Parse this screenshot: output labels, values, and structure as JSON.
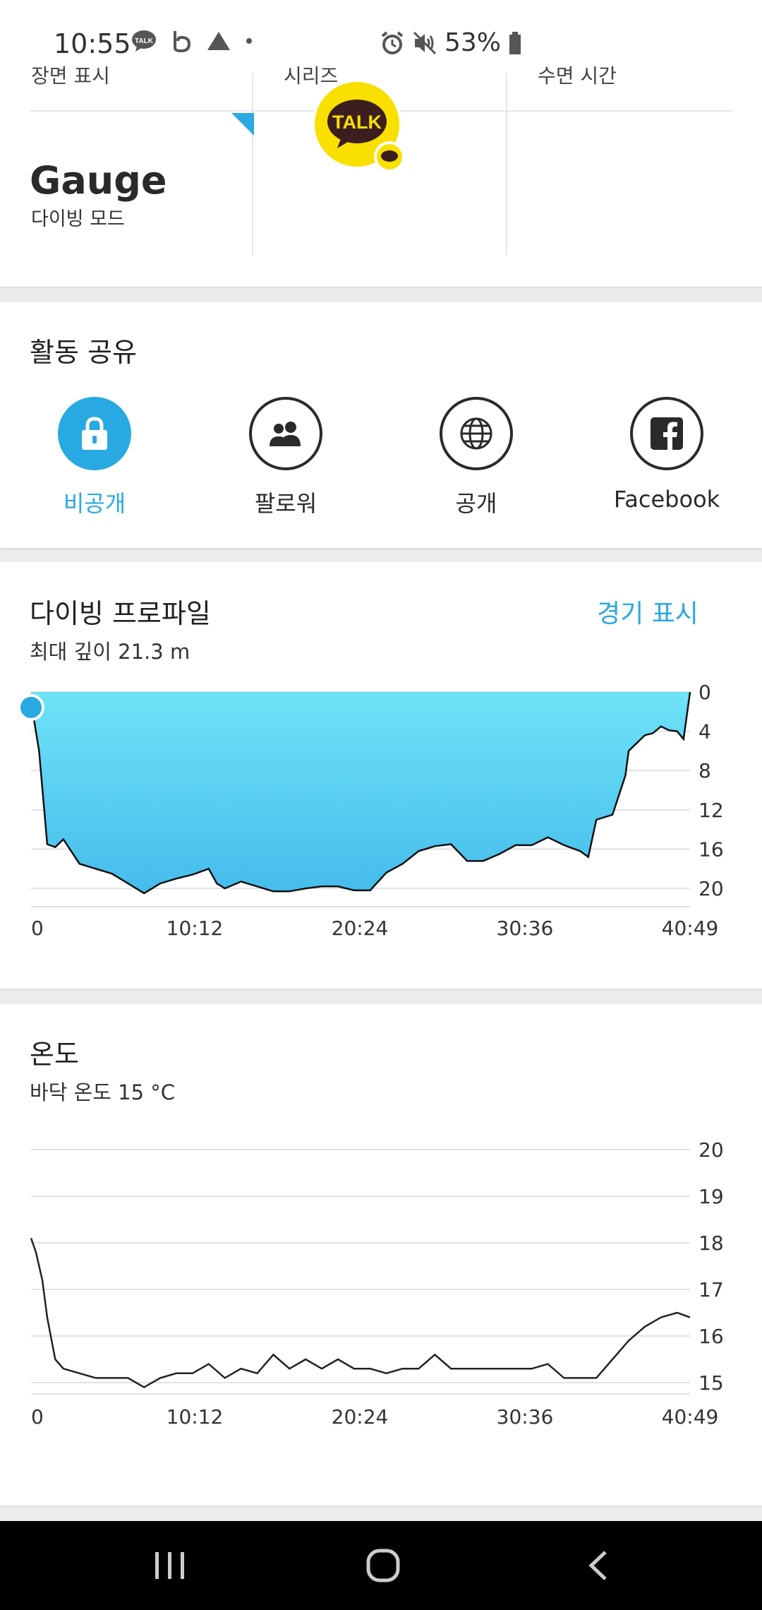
{
  "status_bar": {
    "time": "10:55",
    "battery": "53%"
  },
  "mode_card": {
    "cut_labels": [
      "장면 표시",
      "시리즈",
      "수면 시간"
    ],
    "mode_value": "Gauge",
    "mode_label": "다이빙 모드",
    "kakao_badge": "TALK"
  },
  "share": {
    "title": "활동 공유",
    "options": [
      {
        "label": "비공개",
        "icon": "lock-icon",
        "active": true
      },
      {
        "label": "팔로워",
        "icon": "people-icon",
        "active": false
      },
      {
        "label": "공개",
        "icon": "globe-icon",
        "active": false
      },
      {
        "label": "Facebook",
        "icon": "facebook-icon",
        "active": false
      }
    ],
    "accent": "#29a9e1"
  },
  "depth_profile": {
    "title": "다이빙 프로파일",
    "action": "경기 표시",
    "subtitle": "최대 깊이 21.3 m"
  },
  "temperature": {
    "title": "온도",
    "subtitle": "바닥 온도 15 °C"
  },
  "chart_data": [
    {
      "type": "area",
      "x_tick_labels": [
        "0",
        "10:12",
        "20:24",
        "30:36",
        "40:49"
      ],
      "y_tick_labels": [
        "0",
        "4",
        "8",
        "12",
        "16",
        "20"
      ],
      "ylim": [
        0,
        21
      ],
      "y_inverted": true,
      "xlim": [
        0,
        40.8
      ],
      "x_units": "minutes",
      "grid": true,
      "color": "#4cc4ef",
      "x": [
        0,
        0.5,
        1,
        1.5,
        2,
        3,
        4,
        5,
        6,
        7,
        7.5,
        8,
        9,
        10,
        11,
        11.5,
        12,
        13,
        14,
        15,
        16,
        17,
        18,
        19,
        20,
        21,
        22,
        23,
        24,
        25,
        26,
        27,
        28,
        29,
        30,
        31,
        32,
        33,
        34,
        34.5,
        35,
        36,
        36.8,
        37,
        37.5,
        38,
        38.5,
        39,
        39.5,
        40,
        40.4,
        40.8
      ],
      "y": [
        1,
        6,
        15.5,
        15.8,
        15,
        17.5,
        18,
        18.5,
        19.5,
        20.5,
        20,
        19.5,
        19,
        18.6,
        18,
        19.5,
        20,
        19.3,
        19.8,
        20.3,
        20.3,
        20,
        19.8,
        19.8,
        20.2,
        20.2,
        18.4,
        17.5,
        16.2,
        15.7,
        15.5,
        17.2,
        17.2,
        16.5,
        15.6,
        15.6,
        14.8,
        15.6,
        16.2,
        16.8,
        13,
        12.5,
        8.5,
        6,
        5.2,
        4.4,
        4.2,
        3.5,
        3.9,
        4,
        4.8,
        0
      ]
    },
    {
      "type": "line",
      "x_tick_labels": [
        "0",
        "10:12",
        "20:24",
        "30:36",
        "40:49"
      ],
      "y_tick_labels": [
        "20",
        "19",
        "18",
        "17",
        "16",
        "15"
      ],
      "ylim": [
        14.6,
        20
      ],
      "xlim": [
        0,
        40.8
      ],
      "x_units": "minutes",
      "grid": true,
      "color": "#222222",
      "x": [
        0,
        0.3,
        0.7,
        1,
        1.5,
        2,
        3,
        4,
        5,
        6,
        7,
        8,
        9,
        10,
        11,
        12,
        13,
        14,
        15,
        16,
        17,
        18,
        19,
        20,
        21,
        22,
        23,
        24,
        25,
        26,
        27,
        28,
        29,
        30,
        31,
        32,
        33,
        34,
        35,
        36,
        37,
        38,
        39,
        40,
        40.8
      ],
      "y": [
        18.1,
        17.8,
        17.2,
        16.4,
        15.5,
        15.3,
        15.2,
        15.1,
        15.1,
        15.1,
        14.9,
        15.1,
        15.2,
        15.2,
        15.4,
        15.1,
        15.3,
        15.2,
        15.6,
        15.3,
        15.5,
        15.3,
        15.5,
        15.3,
        15.3,
        15.2,
        15.3,
        15.3,
        15.6,
        15.3,
        15.3,
        15.3,
        15.3,
        15.3,
        15.3,
        15.4,
        15.1,
        15.1,
        15.1,
        15.5,
        15.9,
        16.2,
        16.4,
        16.5,
        16.4
      ]
    }
  ]
}
